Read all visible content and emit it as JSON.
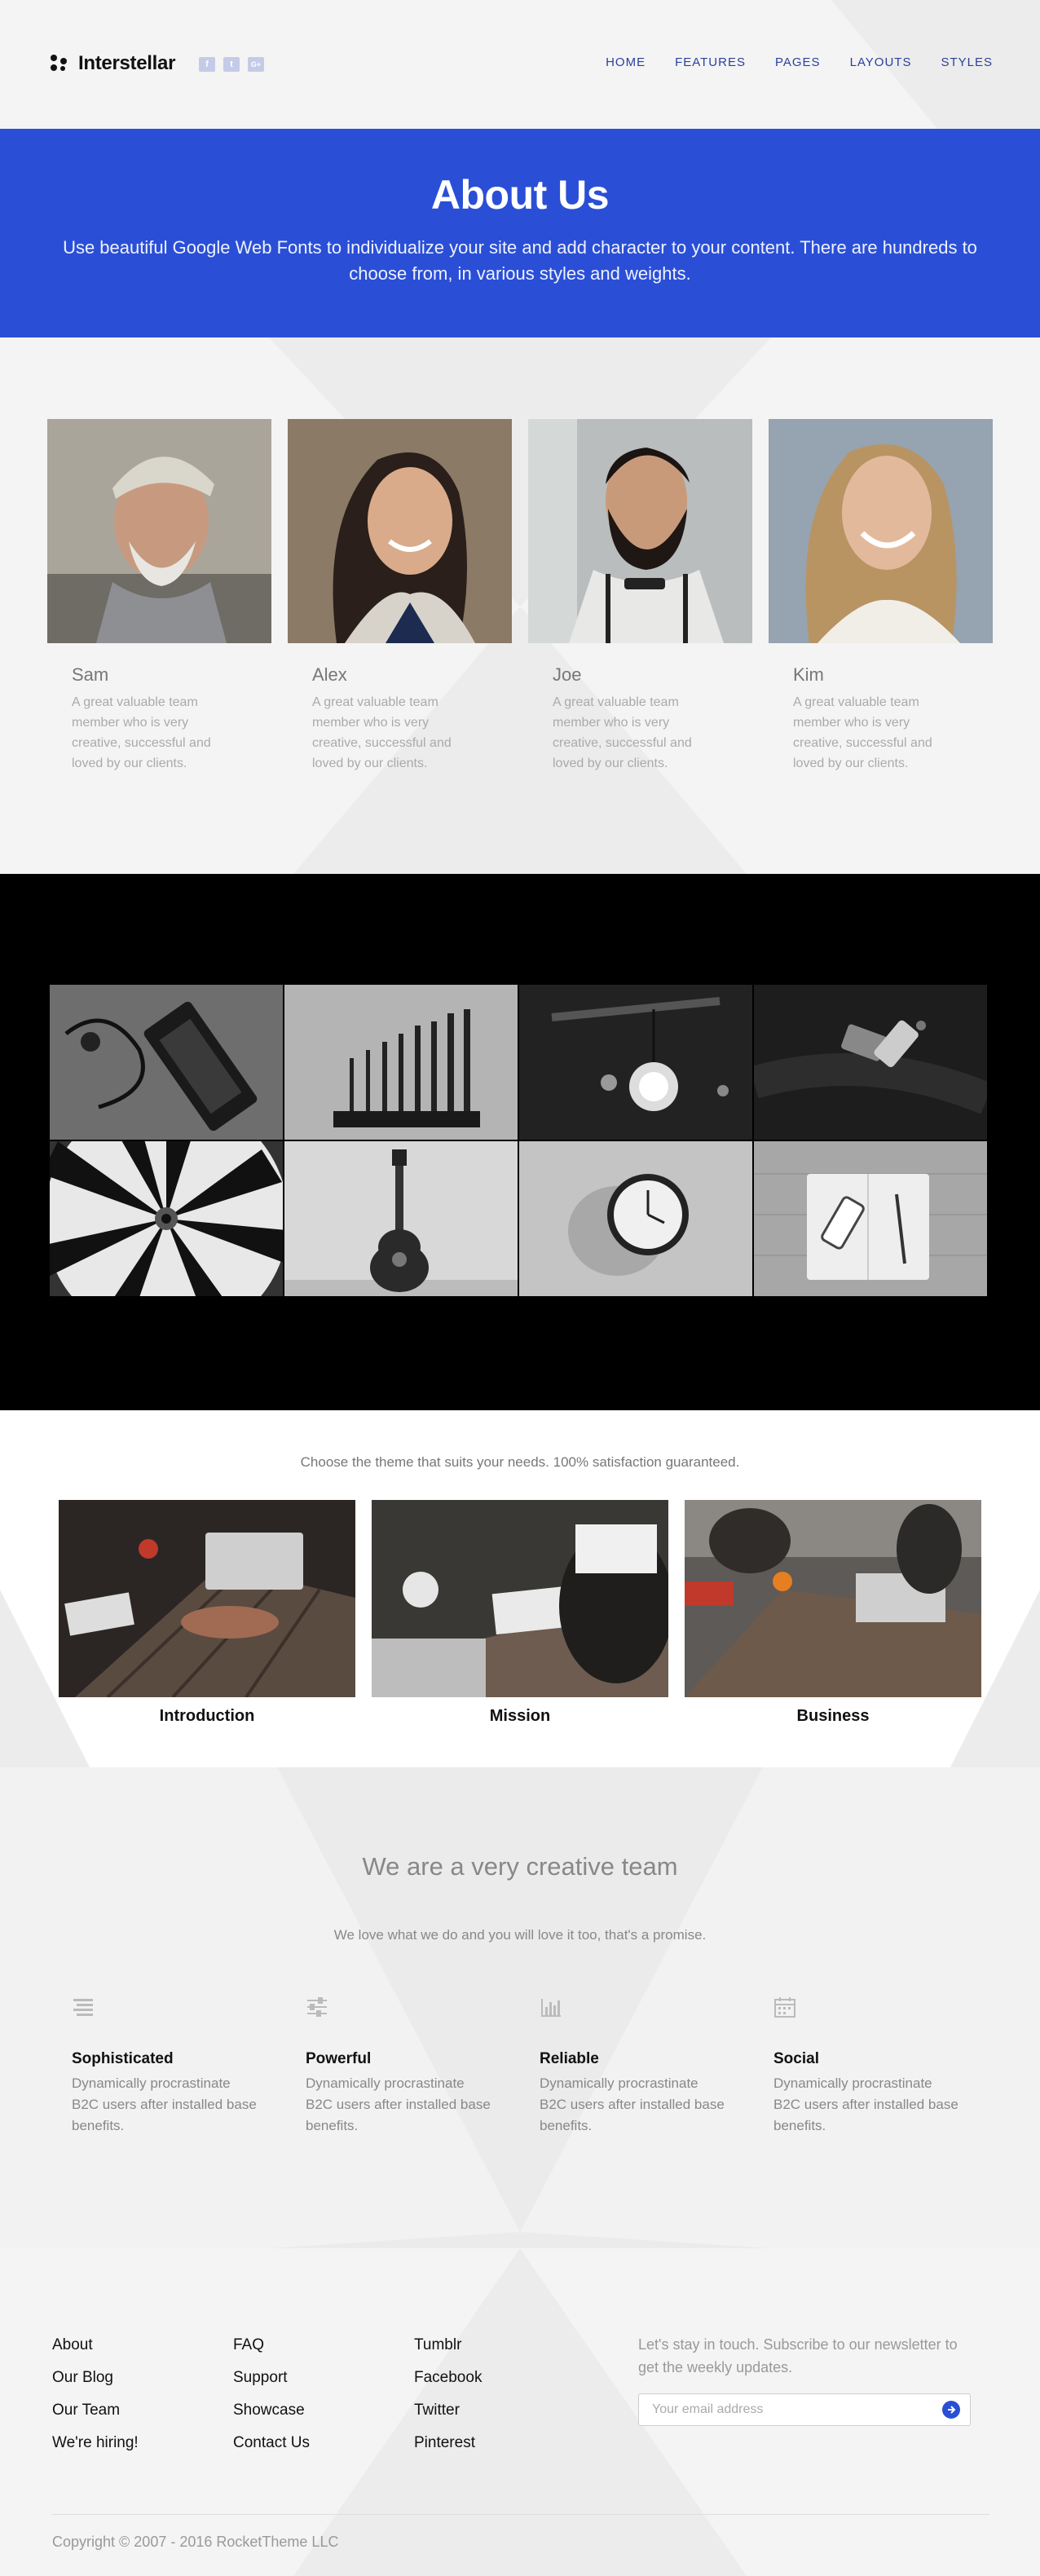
{
  "brand": {
    "name": "Interstellar"
  },
  "socials": [
    {
      "icon": "facebook-icon",
      "glyph": "f"
    },
    {
      "icon": "twitter-icon",
      "glyph": "t"
    },
    {
      "icon": "google-plus-icon",
      "glyph": "G+"
    }
  ],
  "nav": [
    "HOME",
    "FEATURES",
    "PAGES",
    "LAYOUTS",
    "STYLES"
  ],
  "hero": {
    "title": "About Us",
    "text": "Use beautiful Google Web Fonts to individualize your site and add character to your content. There are hundreds to choose from, in various styles and weights."
  },
  "team": [
    {
      "name": "Sam",
      "bio": "A great valuable team member who is very creative, successful and loved by our clients."
    },
    {
      "name": "Alex",
      "bio": "A great valuable team member who is very creative, successful and loved by our clients."
    },
    {
      "name": "Joe",
      "bio": "A great valuable team member who is very creative, successful and loved by our clients."
    },
    {
      "name": "Kim",
      "bio": "A great valuable team member who is very creative, successful and loved by our clients."
    }
  ],
  "gallery": [
    "phone-and-headphones",
    "drill-bits",
    "light-bulb",
    "wallet-and-phone",
    "dartboard",
    "guitar",
    "wall-clock",
    "notebook-phone-pen"
  ],
  "features": {
    "tagline": "Choose the theme that suits your needs. 100% satisfaction guaranteed.",
    "items": [
      "Introduction",
      "Mission",
      "Business"
    ]
  },
  "creative": {
    "title": "We are a very creative team",
    "lead": "We love what we do and you will love it too, that's a promise.",
    "services": [
      {
        "icon": "align-icon",
        "title": "Sophisticated",
        "text": "Dynamically procrastinate B2C users after installed base benefits."
      },
      {
        "icon": "sliders-icon",
        "title": "Powerful",
        "text": "Dynamically procrastinate B2C users after installed base benefits."
      },
      {
        "icon": "bar-chart-icon",
        "title": "Reliable",
        "text": "Dynamically procrastinate B2C users after installed base benefits."
      },
      {
        "icon": "calendar-icon",
        "title": "Social",
        "text": "Dynamically procrastinate B2C users after installed base benefits."
      }
    ]
  },
  "footer": {
    "columns": [
      [
        "About",
        "Our Blog",
        "Our Team",
        "We're hiring!"
      ],
      [
        "FAQ",
        "Support",
        "Showcase",
        "Contact Us"
      ],
      [
        "Tumblr",
        "Facebook",
        "Twitter",
        "Pinterest"
      ]
    ],
    "newsletter_text": "Let's stay in touch. Subscribe to our newsletter to get the weekly updates.",
    "email_placeholder": "Your email address",
    "copyright": "Copyright © 2007 - 2016 RocketTheme LLC"
  },
  "colors": {
    "accent": "#2a4fd6",
    "nav": "#2b3f9e"
  }
}
